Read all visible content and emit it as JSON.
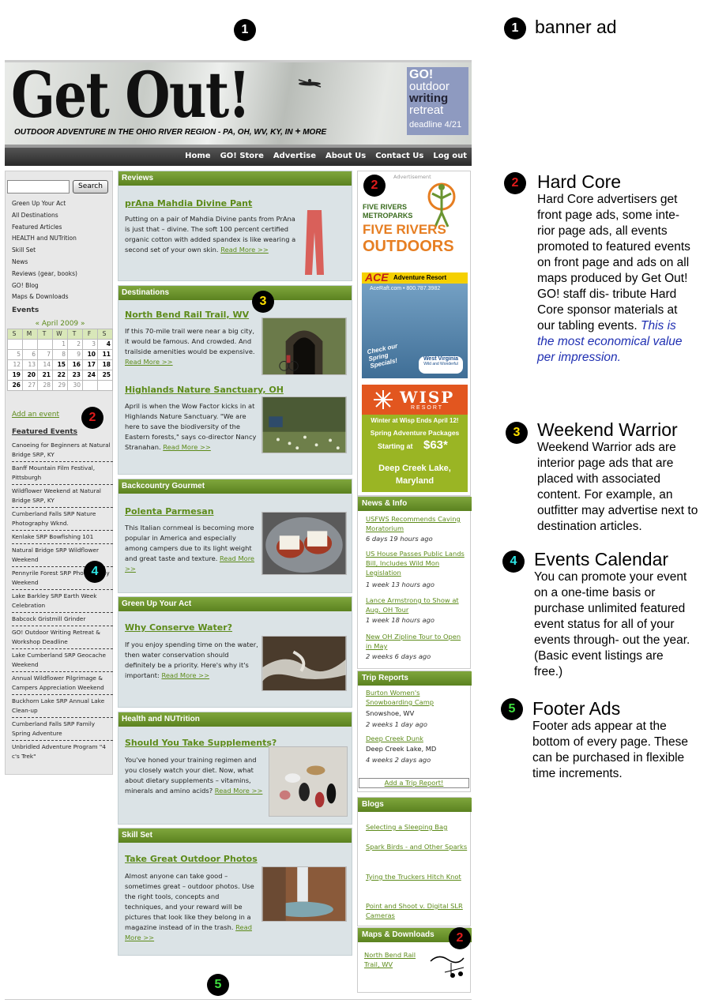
{
  "markers": {
    "m1": "1",
    "m2": "2",
    "m3": "3",
    "m4": "4",
    "m5": "5"
  },
  "annotations": {
    "banner": {
      "title": "banner ad"
    },
    "hardcore": {
      "title": "Hard Core",
      "body": "Hard Core advertisers get front page ads, some inte- rior page ads, all events promoted to featured events on front page and ads on all maps produced by Get Out! GO! staff dis- tribute Hard Core sponsor materials at our tabling events.",
      "emph": "This is the most economical value per impression."
    },
    "weekend": {
      "title": "Weekend Warrior",
      "body": "Weekend Warrior ads are interior page ads that are placed with associated content. For example, an outfitter may advertise next to destination articles."
    },
    "events": {
      "title": "Events Calendar",
      "body": "You can promote your event on a one-time basis or purchase unlimited featured event status for all of your events through- out the year. (Basic event listings are free.)"
    },
    "footer": {
      "title": "Footer Ads",
      "body": "Footer ads appear at the bottom of every page. These can be purchased in flexible time increments."
    }
  },
  "header": {
    "logo": "Get Out!",
    "tagline": "OUTDOOR ADVENTURE IN THE OHIO RIVER REGION - PA, OH, WV, KY, IN",
    "tagline_plus": "+",
    "tagline_more": "MORE",
    "promo": {
      "l1": "GO!",
      "l2": "outdoor",
      "l3": "writing",
      "l4": "retreat",
      "l5": "deadline 4/21"
    }
  },
  "nav": [
    "Home",
    "GO! Store",
    "Advertise",
    "About Us",
    "Contact Us",
    "Log out"
  ],
  "left": {
    "search_button": "Search",
    "links": [
      "Green Up Your Act",
      "All Destinations",
      "Featured Articles",
      "HEALTH and NUTrition",
      "Skill Set",
      "News",
      "Reviews (gear, books)",
      "GO! Blog",
      "Maps & Downloads"
    ],
    "events_heading": "Events",
    "calendar": {
      "month": "« April 2009 »",
      "days": [
        "S",
        "M",
        "T",
        "W",
        "T",
        "F",
        "S"
      ],
      "weeks": [
        [
          "",
          "",
          "",
          "1",
          "2",
          "3",
          "4"
        ],
        [
          "5",
          "6",
          "7",
          "8",
          "9",
          "10",
          "11"
        ],
        [
          "12",
          "13",
          "14",
          "15",
          "16",
          "17",
          "18"
        ],
        [
          "19",
          "20",
          "21",
          "22",
          "23",
          "24",
          "25"
        ],
        [
          "26",
          "27",
          "28",
          "29",
          "30",
          "",
          ""
        ]
      ]
    },
    "add_event": "Add an event",
    "featured_heading": "Featured Events",
    "featured": [
      "Canoeing for Beginners at Natural Bridge SRP, KY",
      "Banff Mountain Film Festival, Pittsburgh",
      "Wildflower Weekend at Natural Bridge SRP, KY",
      "Cumberland Falls SRP Nature Photography Wknd.",
      "Kenlake SRP Bowfishing 101",
      "Natural Bridge SRP Wildflower Weekend",
      "Pennyrile Forest SRP Photography Weekend",
      "Lake Barkley SRP Earth Week Celebration",
      "Babcock Gristmill Grinder",
      "GO! Outdoor Writing Retreat & Workshop Deadline",
      "Lake Cumberland SRP Geocache Weekend",
      "Annual Wildflower Pilgrimage & Campers Appreciation Weekend",
      "Buckhorn Lake SRP Annual Lake Clean-up",
      "Cumberland Falls SRP Family Spring Adventure",
      "Unbridled Adventure Program \"4 c's Trek\""
    ]
  },
  "main": {
    "reviews": {
      "head": "Reviews",
      "title": "prAna Mahdia Divine Pant",
      "text": "Putting on a pair of Mahdia Divine pants from PrAna is just that – divine. The soft 100 percent certified organic cotton with added spandex is like wearing a second set of your own skin.",
      "more": "Read More >>"
    },
    "destinations": {
      "head": "Destinations",
      "a1": {
        "title": "North Bend Rail Trail, WV",
        "text": "If this 70-mile trail were near a big city, it would be famous. And crowded. And trailside amenities would be expensive.",
        "more": "Read More >>"
      },
      "a2": {
        "title": "Highlands Nature Sanctuary, OH",
        "text": "April is when the Wow Factor kicks in at Highlands Nature Sanctuary. \"We are here to save the biodiversity of the Eastern forests,\" says co-director Nancy Stranahan.",
        "more": "Read More >>"
      }
    },
    "gourmet": {
      "head": "Backcountry Gourmet",
      "title": "Polenta Parmesan",
      "text": "This Italian cornmeal is becoming more popular in America and especially among campers due to its light weight and great taste and texture.",
      "more": "Read More >>"
    },
    "green": {
      "head": "Green Up Your Act",
      "title": "Why Conserve Water?",
      "text": "If you enjoy spending time on the water, then water conservation should definitely be a priority. Here's why it's important:",
      "more": "Read More >>"
    },
    "health": {
      "head": "Health and NUTrition",
      "title": "Should You Take Supplements?",
      "text": "You've honed your training regimen and you closely watch your diet. Now, what about dietary supplements – vitamins, minerals and amino acids?",
      "more": "Read More >>"
    },
    "skill": {
      "head": "Skill Set",
      "title": "Take Great Outdoor Photos",
      "text": "Almost anyone can take good – sometimes great – outdoor photos. Use the right tools, concepts and techniques, and your reward will be pictures that look like they belong in a magazine instead of in the trash.",
      "more": "Read More >>"
    }
  },
  "right": {
    "ad_label": "Advertisement",
    "ad1": {
      "l1": "FIVE RIVERS",
      "l2": "METROPARKS",
      "l3": "FIVE RIVERS",
      "l4": "OUTDOORS"
    },
    "ad2": {
      "l1": "ACE",
      "l2": "Adventure Resort",
      "l3": "AceRaft.com • 800.787.3982",
      "l4": "Check our Spring Specials!",
      "l5": "West Virginia",
      "l6": "Wild and Wonderful"
    },
    "ad3": {
      "l1": "WISP",
      "l2": "RESORT",
      "l3": "Winter at Wisp Ends April 12!",
      "l4": "Spring Adventure Packages",
      "l5": "Starting at",
      "l6": "$63*",
      "l7": "Deep Creek Lake,",
      "l8": "Maryland"
    },
    "news": {
      "head": "News & Info",
      "items": [
        {
          "title": "USFWS Recommends Caving Moratorium",
          "meta": "6 days 19 hours ago"
        },
        {
          "title": "US House Passes Public Lands Bill, Includes Wild Mon Legislation",
          "meta": "1 week 13 hours ago"
        },
        {
          "title": "Lance Armstrong to Show at Aug. OH Tour",
          "meta": "1 week 18 hours ago"
        },
        {
          "title": "New OH Zipline Tour to Open in May",
          "meta": "2 weeks 6 days ago"
        }
      ]
    },
    "trips": {
      "head": "Trip Reports",
      "items": [
        {
          "title": "Burton Women's Snowboarding Camp",
          "place": "Snowshoe, WV",
          "meta": "2 weeks 1 day ago"
        },
        {
          "title": "Deep Creek Dunk",
          "place": "Deep Creek Lake, MD",
          "meta": "4 weeks 2 days ago"
        }
      ],
      "add": "Add a Trip Report!"
    },
    "blogs": {
      "head": "Blogs",
      "items": [
        "Selecting a Sleeping Bag",
        "Spark Birds - and Other Sparks",
        "Tying the Truckers Hitch Knot",
        "Point and Shoot v. Digital SLR Cameras"
      ]
    },
    "maps": {
      "head": "Maps & Downloads",
      "item": "North Bend Rail Trail, WV"
    }
  },
  "colors": {
    "green": "#5d8b1a",
    "header_green": "#6a9430",
    "annotation_emphasis": "#1f2fb2"
  }
}
